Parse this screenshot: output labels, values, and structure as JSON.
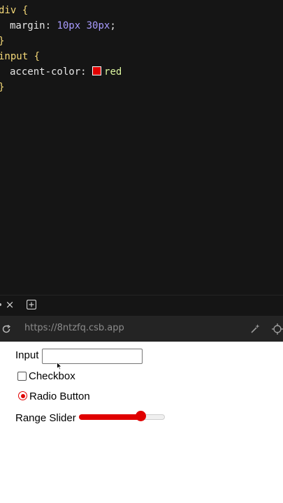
{
  "editor": {
    "rule1": {
      "selector": "div",
      "open_brace": " {",
      "prop": "margin",
      "colon": ": ",
      "val1": "10px",
      "val2": "30px",
      "semi": ";",
      "close_brace": "}"
    },
    "rule2": {
      "selector": "input",
      "open_brace": " {",
      "prop": "accent-color",
      "colon": ": ",
      "value": "red",
      "swatch_color": "#e00000",
      "close_brace": "}"
    }
  },
  "tabbar": {
    "close_glyph": "×"
  },
  "browser": {
    "url": "https://8ntzfq.csb.app"
  },
  "preview": {
    "input_label": "Input",
    "input_value": "",
    "checkbox_label": "Checkbox",
    "checkbox_checked": false,
    "radio_label": "Radio Button",
    "radio_checked": true,
    "range_label": "Range Slider",
    "range_value_fraction": 0.75,
    "accent_color": "#e00000"
  },
  "icons": [
    "close-icon",
    "add-tab-icon",
    "reload-icon",
    "magic-wand-icon",
    "crosshair-icon",
    "mouse-cursor-icon"
  ]
}
